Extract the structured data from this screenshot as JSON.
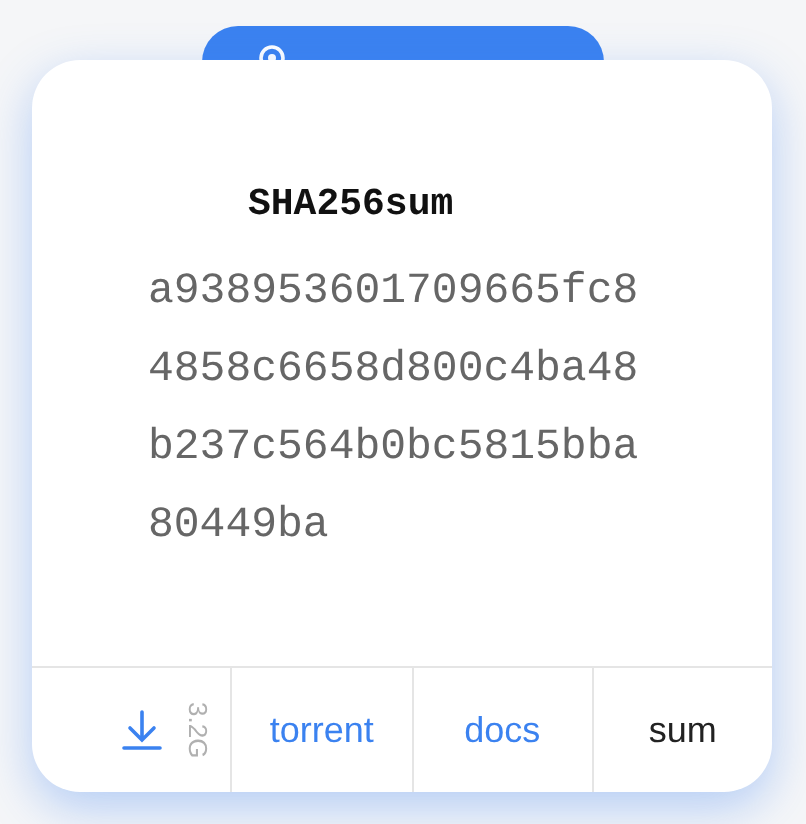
{
  "checksum": {
    "title": "SHA256sum",
    "value": "a938953601709665fc84858c6658d800c4ba48b237c564b0bc5815bba80449ba"
  },
  "footer": [
    {
      "kind": "download",
      "label": "3.2G",
      "selected": false
    },
    {
      "kind": "link",
      "label": "torrent",
      "selected": false
    },
    {
      "kind": "link",
      "label": "docs",
      "selected": false
    },
    {
      "kind": "link",
      "label": "sum",
      "selected": true
    }
  ]
}
